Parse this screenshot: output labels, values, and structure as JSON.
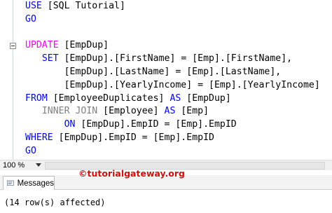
{
  "editor": {
    "lines": [
      [
        {
          "t": "USE ",
          "c": "kw"
        },
        {
          "t": "[SQL Tutorial]",
          "c": "txt"
        }
      ],
      [
        {
          "t": "GO",
          "c": "kw"
        }
      ],
      [],
      [
        {
          "t": "UPDATE ",
          "c": "kw-magenta"
        },
        {
          "t": "[EmpDup]",
          "c": "txt"
        }
      ],
      [
        {
          "t": "   ",
          "c": "txt"
        },
        {
          "t": "SET ",
          "c": "kw"
        },
        {
          "t": "[EmpDup].[FirstName] = [Emp].[FirstName],",
          "c": "txt"
        }
      ],
      [
        {
          "t": "       [EmpDup].[LastName] = [Emp].[LastName],",
          "c": "txt"
        }
      ],
      [
        {
          "t": "       [EmpDup].[YearlyIncome] = [Emp].[YearlyIncome]",
          "c": "txt"
        }
      ],
      [
        {
          "t": "FROM ",
          "c": "kw"
        },
        {
          "t": "[EmployeeDuplicates] ",
          "c": "txt"
        },
        {
          "t": "AS ",
          "c": "kw"
        },
        {
          "t": "[EmpDup]",
          "c": "txt"
        }
      ],
      [
        {
          "t": "   INNER JOIN ",
          "c": "kw-gray"
        },
        {
          "t": "[Employee] ",
          "c": "txt"
        },
        {
          "t": "AS ",
          "c": "kw"
        },
        {
          "t": "[Emp]",
          "c": "txt"
        }
      ],
      [
        {
          "t": "       ",
          "c": "txt"
        },
        {
          "t": "ON ",
          "c": "kw"
        },
        {
          "t": "[EmpDup].EmpID = [Emp].EmpID",
          "c": "txt"
        }
      ],
      [
        {
          "t": "WHERE ",
          "c": "kw"
        },
        {
          "t": "[EmpDup].EmpID = [Emp].EmpID",
          "c": "txt"
        }
      ],
      [
        {
          "t": "GO",
          "c": "kw"
        }
      ]
    ]
  },
  "zoom": {
    "value": "100 %"
  },
  "watermark": "©tutorialgateway.org",
  "results": {
    "tab_label": "Messages",
    "message": "(14 row(s) affected)"
  }
}
